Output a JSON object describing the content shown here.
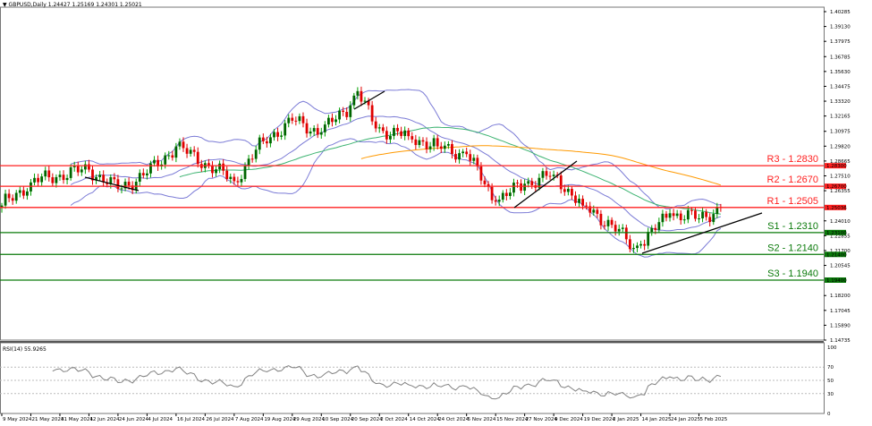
{
  "header": {
    "symbol_label": "GBPUSD,Daily",
    "ohlc": "1.24427 1.25169 1.24301 1.25021",
    "menu_icon": "triangle-down-icon"
  },
  "colors": {
    "bull": "#00a000",
    "bull_body": "#006400",
    "bear": "#e00000",
    "resistance": "#ff2020",
    "support": "#0a7a0a",
    "bollinger": "#7b7bd6",
    "ma_green": "#3cb371",
    "ma_orange": "#ff9900",
    "trendline": "#000000",
    "rsi": "#808080"
  },
  "chart_data": {
    "type": "candlestick",
    "symbol": "GBPUSD",
    "timeframe": "Daily",
    "ylim": [
      1.14735,
      1.40285
    ],
    "y_ticks": [
      "1.40285",
      "1.39130",
      "1.37975",
      "1.36785",
      "1.35630",
      "1.34475",
      "1.33320",
      "1.32165",
      "1.30975",
      "1.29820",
      "1.28665",
      "1.27510",
      "1.26355",
      "1.24010",
      "1.22855",
      "1.21700",
      "1.20545",
      "1.18200",
      "1.17045",
      "1.15890",
      "1.14735"
    ],
    "x_ticks": [
      "9 May 2024",
      "21 May 2024",
      "31 May 2024",
      "12 Jun 2024",
      "24 Jun 2024",
      "4 Jul 2024",
      "16 Jul 2024",
      "26 Jul 2024",
      "7 Aug 2024",
      "19 Aug 2024",
      "29 Aug 2024",
      "10 Sep 2024",
      "20 Sep 2024",
      "2 Oct 2024",
      "14 Oct 2024",
      "24 Oct 2024",
      "5 Nov 2024",
      "15 Nov 2024",
      "27 Nov 2024",
      "9 Dec 2024",
      "19 Dec 2024",
      "2 Jan 2025",
      "14 Jan 2025",
      "24 Jan 2025",
      "5 Feb 2025"
    ],
    "approx_closes": [
      [
        "9 May 2024",
        1.252
      ],
      [
        "21 May 2024",
        1.27
      ],
      [
        "31 May 2024",
        1.276
      ],
      [
        "12 Jun 2024",
        1.28
      ],
      [
        "24 Jun 2024",
        1.265
      ],
      [
        "4 Jul 2024",
        1.277
      ],
      [
        "16 Jul 2024",
        1.298
      ],
      [
        "26 Jul 2024",
        1.285
      ],
      [
        "7 Aug 2024",
        1.271
      ],
      [
        "19 Aug 2024",
        1.302
      ],
      [
        "29 Aug 2024",
        1.318
      ],
      [
        "10 Sep 2024",
        1.309
      ],
      [
        "20 Sep 2024",
        1.33
      ],
      [
        "26 Sep 2024",
        1.341
      ],
      [
        "3 Oct 2024",
        1.312
      ],
      [
        "14 Oct 2024",
        1.306
      ],
      [
        "24 Oct 2024",
        1.298
      ],
      [
        "5 Nov 2024",
        1.292
      ],
      [
        "15 Nov 2024",
        1.255
      ],
      [
        "27 Nov 2024",
        1.269
      ],
      [
        "9 Dec 2024",
        1.276
      ],
      [
        "19 Dec 2024",
        1.252
      ],
      [
        "2 Jan 2025",
        1.237
      ],
      [
        "10 Jan 2025",
        1.219
      ],
      [
        "14 Jan 2025",
        1.222
      ],
      [
        "24 Jan 2025",
        1.246
      ],
      [
        "5 Feb 2025",
        1.242
      ],
      [
        "13 Feb 2025",
        1.2502
      ]
    ],
    "levels": [
      {
        "label": "R3 - 1.2830",
        "price": 1.283,
        "tag": "1.28300",
        "kind": "resistance"
      },
      {
        "label": "R2 - 1.2670",
        "price": 1.267,
        "tag": "1.26700",
        "kind": "resistance"
      },
      {
        "label": "R1 - 1.2505",
        "price": 1.2505,
        "tag": "1.25036",
        "kind": "resistance"
      },
      {
        "label": "S1 - 1.2310",
        "price": 1.231,
        "tag": "1.23100",
        "kind": "support"
      },
      {
        "label": "S2 - 1.2140",
        "price": 1.214,
        "tag": "1.21400",
        "kind": "support"
      },
      {
        "label": "S3 - 1.1940",
        "price": 1.194,
        "tag": "1.19400",
        "kind": "support"
      }
    ],
    "indicators": [
      "Bollinger Bands",
      "Moving Average",
      "Moving Average"
    ],
    "rsi": {
      "label": "RSI(14) 55.9265",
      "period": 14,
      "value": 55.9265,
      "ylim": [
        0,
        100
      ],
      "ticks": [
        "100",
        "70",
        "50",
        "30",
        "0"
      ],
      "levels": [
        70,
        50,
        30
      ]
    }
  }
}
